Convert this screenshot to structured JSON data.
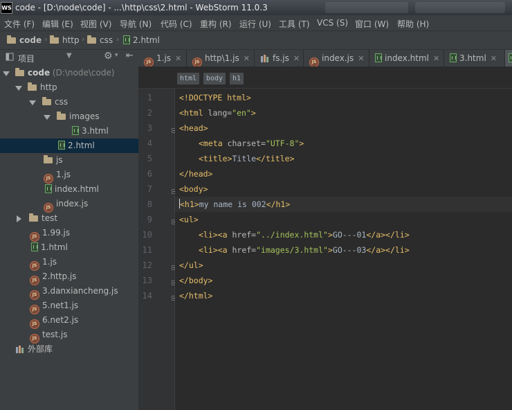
{
  "window": {
    "title": "code - [D:\\node\\code] - ...\\http\\css\\2.html - WebStorm 11.0.3",
    "app_icon": "WS"
  },
  "menu": [
    "文件 (F)",
    "编辑 (E)",
    "视图 (V)",
    "导航 (N)",
    "代码 (C)",
    "重构 (R)",
    "运行 (U)",
    "工具 (T)",
    "VCS (S)",
    "窗口 (W)",
    "帮助 (H)"
  ],
  "breadcrumb": [
    "code",
    "http",
    "css",
    "2.html"
  ],
  "sidebar": {
    "title": "项目",
    "tree": [
      {
        "label": "code",
        "suffix": " (D:\\node\\code)",
        "type": "folder",
        "level": 0,
        "expanded": true
      },
      {
        "label": "http",
        "type": "folder",
        "level": 1,
        "expanded": true
      },
      {
        "label": "css",
        "type": "folder",
        "level": 2,
        "expanded": true
      },
      {
        "label": "images",
        "type": "folder",
        "level": 3,
        "expanded": true
      },
      {
        "label": "3.html",
        "type": "html",
        "level": 4
      },
      {
        "label": "2.html",
        "type": "html",
        "level": 3,
        "selected": true
      },
      {
        "label": "js",
        "type": "folder",
        "level": 2
      },
      {
        "label": "1.js",
        "type": "js",
        "level": 2
      },
      {
        "label": "index.html",
        "type": "html",
        "level": 2
      },
      {
        "label": "index.js",
        "type": "js",
        "level": 2
      },
      {
        "label": "test",
        "type": "folder",
        "level": 1,
        "collapsed": true
      },
      {
        "label": "1.99.js",
        "type": "js",
        "level": 1
      },
      {
        "label": "1.html",
        "type": "html",
        "level": 1
      },
      {
        "label": "1.js",
        "type": "js",
        "level": 1
      },
      {
        "label": "2.http.js",
        "type": "js",
        "level": 1
      },
      {
        "label": "3.danxiancheng.js",
        "type": "js",
        "level": 1
      },
      {
        "label": "5.net1.js",
        "type": "js",
        "level": 1
      },
      {
        "label": "6.net2.js",
        "type": "js",
        "level": 1
      },
      {
        "label": "test.js",
        "type": "js",
        "level": 1
      },
      {
        "label": "外部库",
        "type": "library",
        "level": 0
      }
    ]
  },
  "tabs": [
    {
      "label": "1.js",
      "type": "js"
    },
    {
      "label": "http\\1.js",
      "type": "js"
    },
    {
      "label": "fs.js",
      "type": "js-lib"
    },
    {
      "label": "index.js",
      "type": "js"
    },
    {
      "label": "index.html",
      "type": "html"
    },
    {
      "label": "3.html",
      "type": "html"
    }
  ],
  "tag_breadcrumb": [
    "html",
    "body",
    "h1"
  ],
  "code_lines": [
    "1",
    "2",
    "3",
    "4",
    "5",
    "6",
    "7",
    "8",
    "9",
    "10",
    "11",
    "12",
    "13",
    "14"
  ],
  "code": [
    {
      "segments": [
        [
          "tg",
          "<!DOCTYPE html>"
        ]
      ]
    },
    {
      "segments": [
        [
          "tg",
          "<html "
        ],
        [
          "at",
          "lang="
        ],
        [
          "st",
          "\"en\""
        ],
        [
          "tg",
          ">"
        ]
      ]
    },
    {
      "segments": [
        [
          "tg",
          "<head>"
        ]
      ]
    },
    {
      "indent": 1,
      "segments": [
        [
          "tg",
          "<meta "
        ],
        [
          "at",
          "charset="
        ],
        [
          "st",
          "\"UTF-8\""
        ],
        [
          "tg",
          ">"
        ]
      ]
    },
    {
      "indent": 1,
      "segments": [
        [
          "tg",
          "<title>"
        ],
        [
          "txt",
          "Title"
        ],
        [
          "tg",
          "</title>"
        ]
      ]
    },
    {
      "segments": [
        [
          "tg",
          "</head>"
        ]
      ]
    },
    {
      "segments": [
        [
          "tg",
          "<body>"
        ]
      ]
    },
    {
      "current": true,
      "segments": [
        [
          "tg",
          "<h1>"
        ],
        [
          "txt",
          "my name is 002"
        ],
        [
          "tg",
          "</h1>"
        ]
      ]
    },
    {
      "segments": [
        [
          "tg",
          "<ul>"
        ]
      ]
    },
    {
      "indent": 1,
      "segments": [
        [
          "tg",
          "<li><a "
        ],
        [
          "at",
          "href="
        ],
        [
          "st",
          "\"../index.html\""
        ],
        [
          "tg",
          ">"
        ],
        [
          "txt",
          "GO---01"
        ],
        [
          "tg",
          "</a></li>"
        ]
      ]
    },
    {
      "indent": 1,
      "segments": [
        [
          "tg",
          "<li><a "
        ],
        [
          "at",
          "href="
        ],
        [
          "st",
          "\"images/3.html\""
        ],
        [
          "tg",
          ">"
        ],
        [
          "txt",
          "GO---03"
        ],
        [
          "tg",
          "</a></li>"
        ]
      ]
    },
    {
      "segments": [
        [
          "tg",
          "</ul>"
        ]
      ]
    },
    {
      "segments": [
        [
          "tg",
          "</body>"
        ]
      ]
    },
    {
      "segments": [
        [
          "tg",
          "</html>"
        ]
      ]
    }
  ],
  "colors": {
    "editor_bg": "#2b2b2b",
    "panel_bg": "#3c3f41",
    "tag": "#e8bf6a",
    "string": "#a5c25c",
    "selection": "#0d293e"
  }
}
